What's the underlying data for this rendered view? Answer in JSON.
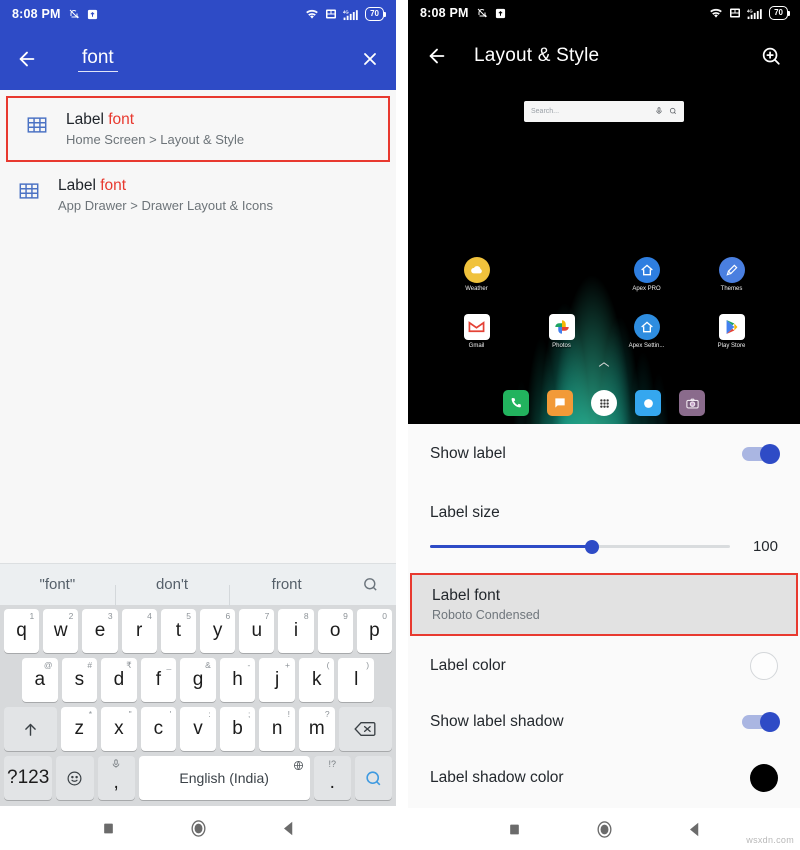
{
  "left_phone": {
    "status_bar": {
      "time": "8:08 PM",
      "icons": [
        "mute-icon",
        "upload-badge-icon",
        "wifi-icon",
        "vpn-icon",
        "signal-4g-icon"
      ],
      "battery": "70"
    },
    "app_bar": {
      "back_icon": "back-arrow-icon",
      "query": "font",
      "clear_icon": "close-icon"
    },
    "results": [
      {
        "icon": "grid-icon",
        "title_prefix": "Label ",
        "title_match": "font",
        "subtitle": "Home Screen > Layout & Style",
        "highlighted": true
      },
      {
        "icon": "grid-icon",
        "title_prefix": "Label ",
        "title_match": "font",
        "subtitle": "App Drawer > Drawer Layout & Icons",
        "highlighted": false
      }
    ],
    "keyboard": {
      "suggestions": [
        "\"font\"",
        "don't",
        "front"
      ],
      "suggestion_search_icon": "search-icon",
      "row1": [
        {
          "k": "q",
          "hint": "1"
        },
        {
          "k": "w",
          "hint": "2"
        },
        {
          "k": "e",
          "hint": "3"
        },
        {
          "k": "r",
          "hint": "4"
        },
        {
          "k": "t",
          "hint": "5"
        },
        {
          "k": "y",
          "hint": "6"
        },
        {
          "k": "u",
          "hint": "7"
        },
        {
          "k": "i",
          "hint": "8"
        },
        {
          "k": "o",
          "hint": "9"
        },
        {
          "k": "p",
          "hint": "0"
        }
      ],
      "row2": [
        {
          "k": "a",
          "hint": "@"
        },
        {
          "k": "s",
          "hint": "#"
        },
        {
          "k": "d",
          "hint": "₹"
        },
        {
          "k": "f",
          "hint": "_"
        },
        {
          "k": "g",
          "hint": "&"
        },
        {
          "k": "h",
          "hint": "-"
        },
        {
          "k": "j",
          "hint": "+"
        },
        {
          "k": "k",
          "hint": "("
        },
        {
          "k": "l",
          "hint": ")"
        }
      ],
      "row3": [
        {
          "k": "z",
          "hint": "*"
        },
        {
          "k": "x",
          "hint": "\""
        },
        {
          "k": "c",
          "hint": "'"
        },
        {
          "k": "v",
          "hint": ":"
        },
        {
          "k": "b",
          "hint": ";"
        },
        {
          "k": "n",
          "hint": "!"
        },
        {
          "k": "m",
          "hint": "?"
        }
      ],
      "shift_icon": "shift-up-arrow-icon",
      "backspace_icon": "backspace-icon",
      "symbols_key": "?123",
      "emoji_icon": "emoji-smiley-icon",
      "comma_key": ",",
      "comma_hint": "mic-icon",
      "space_key": "English (India)",
      "space_hint": "globe-icon",
      "period_key": ".",
      "period_hint": "!?",
      "enter_search_icon": "search-icon"
    },
    "nav_bar": {
      "recents_icon": "square-recents-icon",
      "home_icon": "circle-home-icon",
      "back_icon": "triangle-back-icon"
    }
  },
  "right_phone": {
    "status_bar": {
      "time": "8:08 PM",
      "icons": [
        "mute-icon",
        "upload-badge-icon",
        "wifi-icon",
        "vpn-icon",
        "signal-4g-icon"
      ],
      "battery": "70"
    },
    "app_bar": {
      "back_icon": "back-arrow-icon",
      "title": "Layout & Style",
      "search_icon": "search-zoom-icon"
    },
    "preview": {
      "search_widget_placeholder": "Search...",
      "search_widget_mic_icon": "microphone-icon",
      "search_widget_search_icon": "search-icon",
      "apps": [
        [
          {
            "label": "Weather",
            "icon": "weather-icon",
            "color": "#f0c23c",
            "glyph": "☁"
          },
          {
            "label": "",
            "icon": "",
            "color": "",
            "glyph": ""
          },
          {
            "label": "Apex PRO",
            "icon": "apex-pro-icon",
            "color": "#2e7ee0",
            "glyph": "⌂"
          },
          {
            "label": "Themes",
            "icon": "themes-icon",
            "color": "#4a7fe0",
            "glyph": "✎"
          }
        ],
        [
          {
            "label": "Gmail",
            "icon": "gmail-icon",
            "color": "#ffffff",
            "glyph": "M"
          },
          {
            "label": "Photos",
            "icon": "photos-icon",
            "color": "#ffffff",
            "glyph": "✹"
          },
          {
            "label": "Apex Settin...",
            "icon": "apex-settings-icon",
            "color": "#2e8de0",
            "glyph": "⌂"
          },
          {
            "label": "Play Store",
            "icon": "play-store-icon",
            "color": "#ffffff",
            "glyph": "▶"
          }
        ]
      ],
      "page_indicator_icon": "chevron-up-icon",
      "dock": [
        {
          "icon": "phone-icon",
          "color": "#22b35e",
          "glyph": "✆"
        },
        {
          "icon": "messages-icon",
          "color": "#f29a38",
          "glyph": "✉"
        },
        {
          "icon": "app-drawer-icon",
          "color": "#ffffff",
          "glyph": "⁙"
        },
        {
          "icon": "browser-icon",
          "color": "#35a7ef",
          "glyph": "●"
        },
        {
          "icon": "camera-icon",
          "color": "#8a6b8c",
          "glyph": "◉"
        }
      ]
    },
    "settings": [
      {
        "type": "toggle",
        "label": "Show label",
        "value": "on",
        "highlighted": false
      },
      {
        "type": "slider",
        "label": "Label size",
        "value": "100",
        "percent": 54,
        "highlighted": false
      },
      {
        "type": "text",
        "label": "Label font",
        "sub": "Roboto Condensed",
        "highlighted": true
      },
      {
        "type": "color",
        "label": "Label color",
        "swatch": "white",
        "highlighted": false
      },
      {
        "type": "toggle",
        "label": "Show label shadow",
        "value": "on",
        "highlighted": false
      },
      {
        "type": "color",
        "label": "Label shadow color",
        "swatch": "black",
        "highlighted": false
      }
    ],
    "nav_bar": {
      "recents_icon": "square-recents-icon",
      "home_icon": "circle-home-icon",
      "back_icon": "triangle-back-icon"
    }
  },
  "watermark": "wsxdn.com",
  "colors": {
    "accent_blue": "#2e4bc6",
    "highlight_red": "#e8392f",
    "match_red": "#e8392f"
  }
}
